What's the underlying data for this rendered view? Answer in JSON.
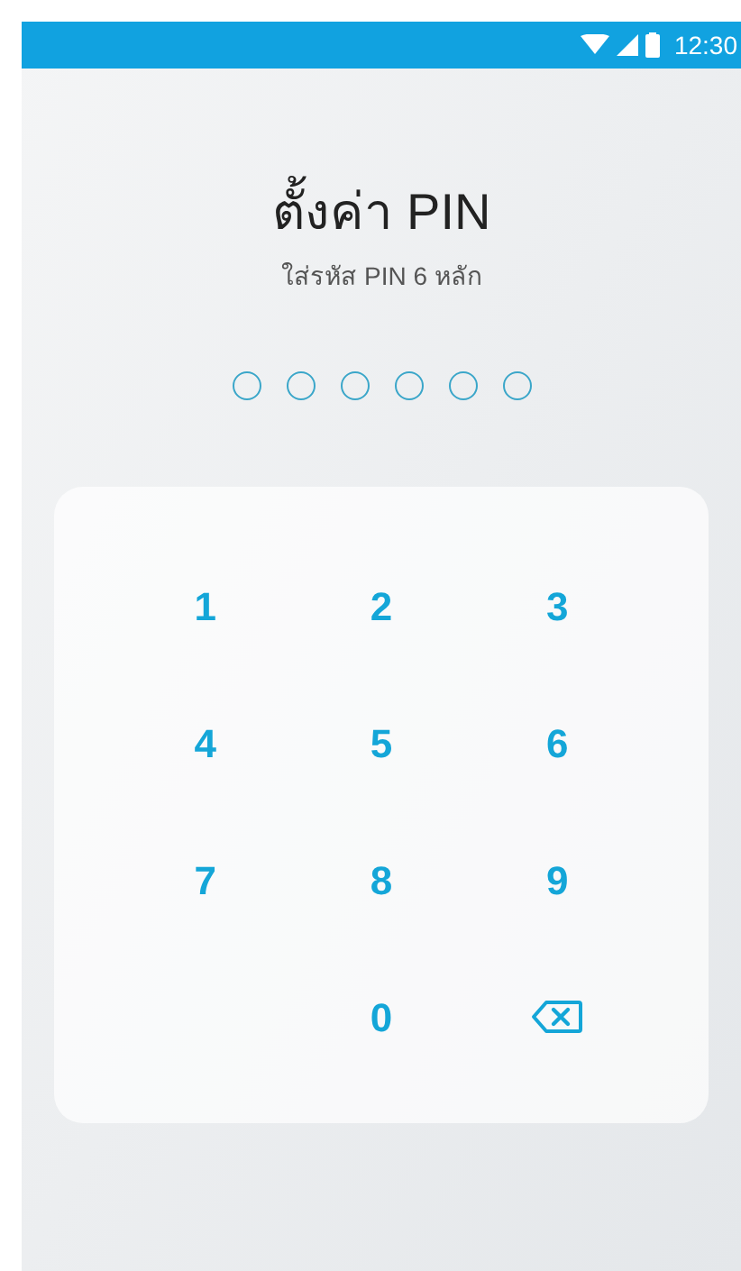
{
  "status_bar": {
    "time": "12:30"
  },
  "title": "ตั้งค่า PIN",
  "subtitle": "ใส่รหัส PIN 6 หลัก",
  "pin_dots": [
    {
      "filled": false
    },
    {
      "filled": false
    },
    {
      "filled": false
    },
    {
      "filled": false
    },
    {
      "filled": false
    },
    {
      "filled": false
    }
  ],
  "keypad": [
    {
      "kind": "digit",
      "label": "1"
    },
    {
      "kind": "digit",
      "label": "2"
    },
    {
      "kind": "digit",
      "label": "3"
    },
    {
      "kind": "digit",
      "label": "4"
    },
    {
      "kind": "digit",
      "label": "5"
    },
    {
      "kind": "digit",
      "label": "6"
    },
    {
      "kind": "digit",
      "label": "7"
    },
    {
      "kind": "digit",
      "label": "8"
    },
    {
      "kind": "digit",
      "label": "9"
    },
    {
      "kind": "blank"
    },
    {
      "kind": "digit",
      "label": "0"
    },
    {
      "kind": "backspace"
    }
  ]
}
